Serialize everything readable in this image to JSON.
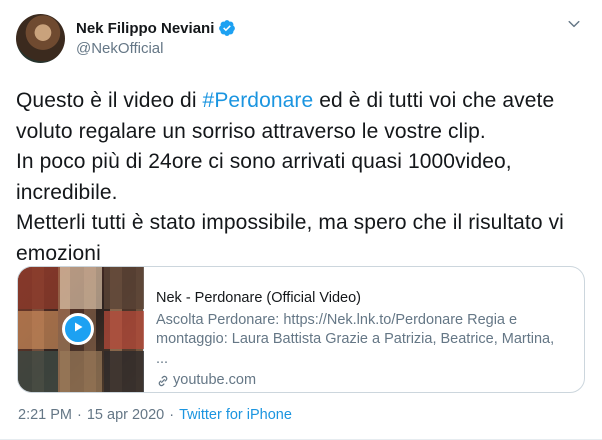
{
  "author": {
    "display_name": "Nek Filippo Neviani",
    "handle": "@NekOfficial",
    "verified": true
  },
  "tweet": {
    "text_before": "Questo è il video di ",
    "hashtag": "#Perdonare",
    "text_after": " ed è di tutti voi che avete voluto regalare un sorriso attraverso le vostre clip.\nIn poco più di 24ore ci sono arrivati quasi 1000video, incredibile.\nMetterli tutti è stato impossibile, ma spero che il risultato vi emozioni"
  },
  "card": {
    "title": "Nek - Perdonare (Official Video)",
    "description": "Ascolta Perdonare: https://Nek.lnk.to/Perdonare Regia e montaggio: Laura Battista Grazie a Patrizia, Beatrice, Martina, ...",
    "domain": "youtube.com"
  },
  "meta": {
    "time": "2:21 PM",
    "separator": "·",
    "date": "15 apr 2020",
    "source": "Twitter for iPhone"
  },
  "colors": {
    "link": "#1b95e0",
    "secondary_text": "#657786",
    "verified": "#1da1f2"
  },
  "icons": [
    "verified-badge-icon",
    "chevron-down-icon",
    "play-icon",
    "link-icon"
  ]
}
